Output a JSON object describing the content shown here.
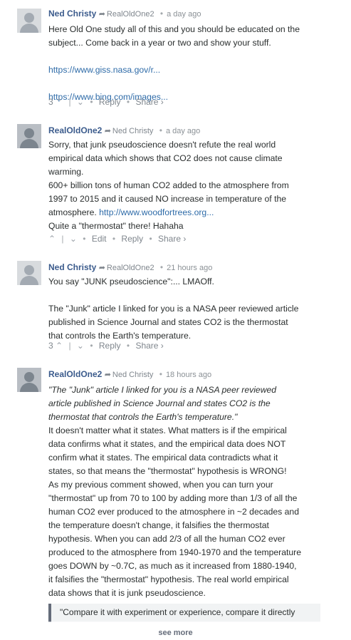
{
  "comments": [
    {
      "author": "Ned Christy",
      "reply_to": "RealOldOne2",
      "time": "a day ago",
      "avatar_icon": "default-avatar-icon",
      "body": [
        "Here Old One study all of this and you should be educated on the",
        "subject... Come back in a year or two and show your stuff."
      ],
      "links": [
        "https://www.giss.nasa.gov/r...",
        "https://www.bing.com/images..."
      ],
      "votes": "3",
      "actions": [
        "Reply",
        "Share ›"
      ]
    },
    {
      "author": "RealOldOne2",
      "reply_to": "Ned Christy",
      "time": "a day ago",
      "avatar_icon": "user-photo-avatar-icon",
      "body": [
        "Sorry, that junk pseudoscience doesn't refute the real world",
        "empirical data which shows that CO2 does not cause climate",
        "warming.",
        "600+ billion tons of human CO2 added to the atmosphere from",
        "1997 to 2015 and it caused NO increase in temperature of the",
        "atmosphere.",
        "Quite a \"thermostat\" there! Hahaha"
      ],
      "link": "http://www.woodfortrees.org...",
      "actions": [
        "Edit",
        "Reply",
        "Share ›"
      ]
    },
    {
      "author": "Ned Christy",
      "reply_to": "RealOldOne2",
      "time": "21 hours ago",
      "avatar_icon": "default-avatar-icon",
      "body": [
        "You say \"JUNK pseudoscience\":... LMAOff.",
        "The \"Junk\" article I linked for you is a NASA peer reviewed article",
        "published in Science Journal and states CO2 is the thermostat",
        "that controls the Earth's temperature."
      ],
      "votes": "3",
      "actions": [
        "Reply",
        "Share ›"
      ]
    },
    {
      "author": "RealOldOne2",
      "reply_to": "Ned Christy",
      "time": "18 hours ago",
      "avatar_icon": "user-photo-avatar-icon",
      "quote": [
        "\"The \"Junk\" article I linked for you is a NASA peer reviewed",
        "article published in Science Journal and states CO2 is the",
        "thermostat that controls the Earth's temperature.\""
      ],
      "body": [
        "It doesn't matter what it states. What matters is if the empirical",
        "data confirms what it states, and the empirical data does NOT",
        "confirm what it states. The empirical data contradicts what it",
        "states, so that means the \"thermostat\" hypothesis is WRONG!",
        "As my previous comment showed, when you can turn your",
        "\"thermostat\" up from 70 to 100 by adding more than 1/3 of all the",
        "human CO2 ever produced to the atmosphere in ~2 decades and",
        "the temperature doesn't change, it falsifies the thermostat",
        "hypothesis. When you can add 2/3 of all the human CO2 ever",
        "produced to the atmosphere from 1940-1970 and the temperature",
        "goes DOWN by ~0.7C, as much as it increased from 1880-1940,",
        "it falsifies the \"thermostat\" hypothesis. The real world empirical",
        "data shows that it is junk pseudoscience."
      ],
      "blockquote": "\"Compare it with experiment or experience, compare it directly"
    }
  ],
  "see_more": "see more",
  "colors": {
    "link": "#2e6ba8",
    "author": "#3b5b8c",
    "meta": "#7f868d"
  }
}
